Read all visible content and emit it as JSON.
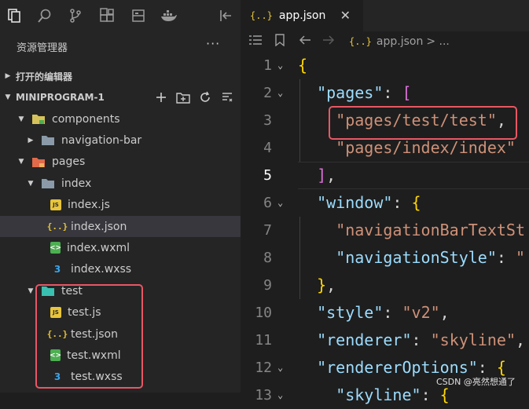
{
  "activity_bar": {
    "icons": [
      "explorer-icon",
      "search-icon",
      "source-control-icon",
      "extensions-icon",
      "debug-icon",
      "docker-icon",
      "collapse-panel-icon"
    ]
  },
  "explorer": {
    "title": "资源管理器",
    "more": "···",
    "open_editors": "打开的编辑器",
    "project": "MINIPROGRAM-1",
    "tree": [
      {
        "label": "components",
        "depth": 1,
        "kind": "folder-components",
        "twisty": "down"
      },
      {
        "label": "navigation-bar",
        "depth": 2,
        "kind": "folder",
        "twisty": "right"
      },
      {
        "label": "pages",
        "depth": 1,
        "kind": "folder-pages",
        "twisty": "down"
      },
      {
        "label": "index",
        "depth": 2,
        "kind": "folder",
        "twisty": "down"
      },
      {
        "label": "index.js",
        "depth": 3,
        "kind": "js"
      },
      {
        "label": "index.json",
        "depth": 3,
        "kind": "json",
        "selected": true
      },
      {
        "label": "index.wxml",
        "depth": 3,
        "kind": "wxml"
      },
      {
        "label": "index.wxss",
        "depth": 3,
        "kind": "wxss"
      },
      {
        "label": "test",
        "depth": 2,
        "kind": "folder-open",
        "twisty": "down"
      },
      {
        "label": "test.js",
        "depth": 3,
        "kind": "js"
      },
      {
        "label": "test.json",
        "depth": 3,
        "kind": "json"
      },
      {
        "label": "test.wxml",
        "depth": 3,
        "kind": "wxml"
      },
      {
        "label": "test.wxss",
        "depth": 3,
        "kind": "wxss"
      }
    ],
    "icon_glyphs": {
      "js": "JS",
      "json": "{..}",
      "wxml": "<>",
      "wxss": "3"
    }
  },
  "editor": {
    "tab_label": "app.json",
    "tab_icon": "{..}",
    "tab_close": "✕",
    "breadcrumb_file": "app.json",
    "breadcrumb_more": "> ...",
    "lines": [
      {
        "n": "1",
        "text": "{"
      },
      {
        "n": "2",
        "text": "  \"pages\": ["
      },
      {
        "n": "3",
        "text": "    \"pages/test/test\","
      },
      {
        "n": "4",
        "text": "    \"pages/index/index\""
      },
      {
        "n": "5",
        "text": "  ],"
      },
      {
        "n": "6",
        "text": "  \"window\": {"
      },
      {
        "n": "7",
        "text": "    \"navigationBarTextSt"
      },
      {
        "n": "8",
        "text": "    \"navigationStyle\": \""
      },
      {
        "n": "9",
        "text": "  },"
      },
      {
        "n": "10",
        "text": "  \"style\": \"v2\","
      },
      {
        "n": "11",
        "text": "  \"renderer\": \"skyline\","
      },
      {
        "n": "12",
        "text": "  \"rendererOptions\": {"
      },
      {
        "n": "13",
        "text": "    \"skyline\": {"
      }
    ]
  },
  "watermark": "CSDN @亮然想通了",
  "colors": {
    "highlight_box": "#e85764",
    "selected_row": "#37373d"
  }
}
